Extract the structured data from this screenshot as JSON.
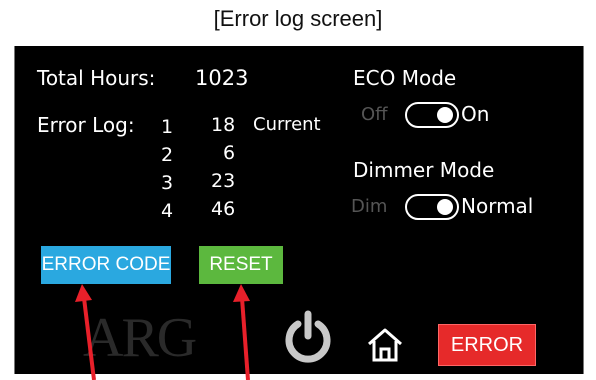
{
  "caption": "[Error log screen]",
  "total_hours": {
    "label": "Total Hours:",
    "value": "1023"
  },
  "error_log": {
    "label": "Error Log:",
    "rows": [
      {
        "index": "1",
        "value": "18",
        "note": "Current"
      },
      {
        "index": "2",
        "value": "6"
      },
      {
        "index": "3",
        "value": "23"
      },
      {
        "index": "4",
        "value": "46"
      }
    ]
  },
  "eco_mode": {
    "title": "ECO Mode",
    "off_label": "Off",
    "on_label": "On",
    "state": "On"
  },
  "dimmer_mode": {
    "title": "Dimmer Mode",
    "off_label": "Dim",
    "on_label": "Normal",
    "state": "Normal"
  },
  "buttons": {
    "error_code": "ERROR CODE",
    "reset": "RESET",
    "error": "ERROR"
  },
  "logo": "ARG",
  "icons": [
    "power-icon",
    "home-icon"
  ],
  "colors": {
    "error_code": "#2aa8e0",
    "reset": "#5cb83e",
    "error": "#e62a2a",
    "arrow": "#e8202a"
  }
}
